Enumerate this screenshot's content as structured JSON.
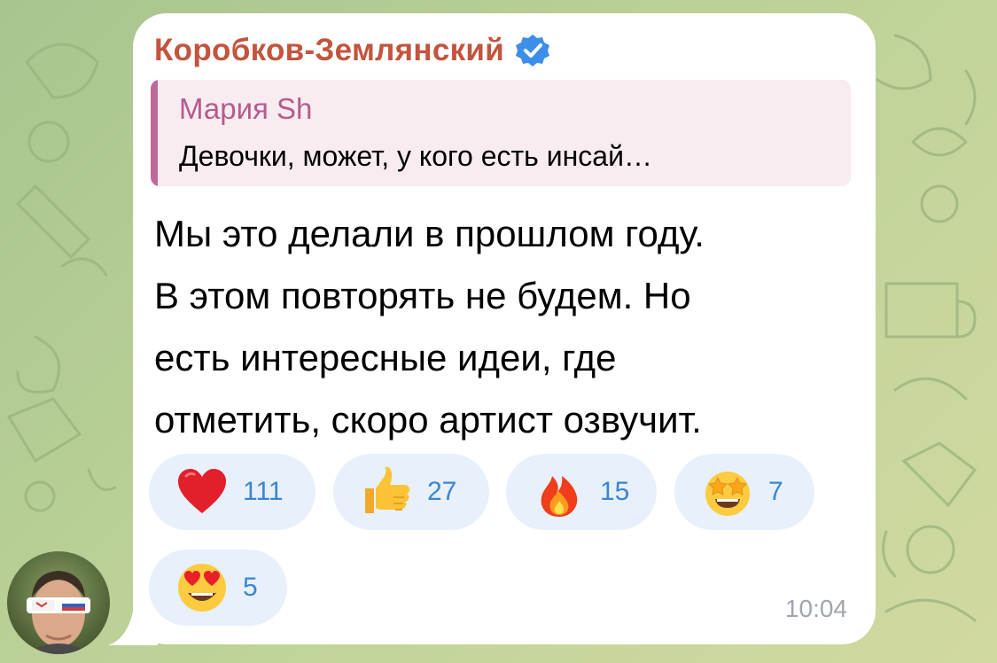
{
  "colors": {
    "sender_name": "#c3543d",
    "reply_accent": "#c0679a",
    "reaction_count": "#3a86d6",
    "reaction_bg": "#e7f0fb",
    "bubble_bg": "#ffffff",
    "verified_badge": "#3d8ee8"
  },
  "message": {
    "sender_name": "Коробков-Землянский",
    "sender_verified_icon": "verified-badge-icon",
    "reply": {
      "author": "Мария Sh",
      "preview": "Девочки, может, у кого есть инсай…"
    },
    "text_lines": [
      "Мы это делали в прошлом году.",
      "В этом повторять не будем. Но",
      "есть интересные идеи, где",
      "отметить, скоро артист озвучит."
    ],
    "reactions": [
      {
        "icon": "red-heart-icon",
        "count": "111"
      },
      {
        "icon": "thumbs-up-icon",
        "count": "27"
      },
      {
        "icon": "fire-icon",
        "count": "15"
      },
      {
        "icon": "star-struck-face-icon",
        "count": "7"
      },
      {
        "icon": "heart-eyes-face-icon",
        "count": "5"
      }
    ],
    "time": "10:04"
  },
  "avatar": {
    "icon": "user-avatar-photo"
  }
}
